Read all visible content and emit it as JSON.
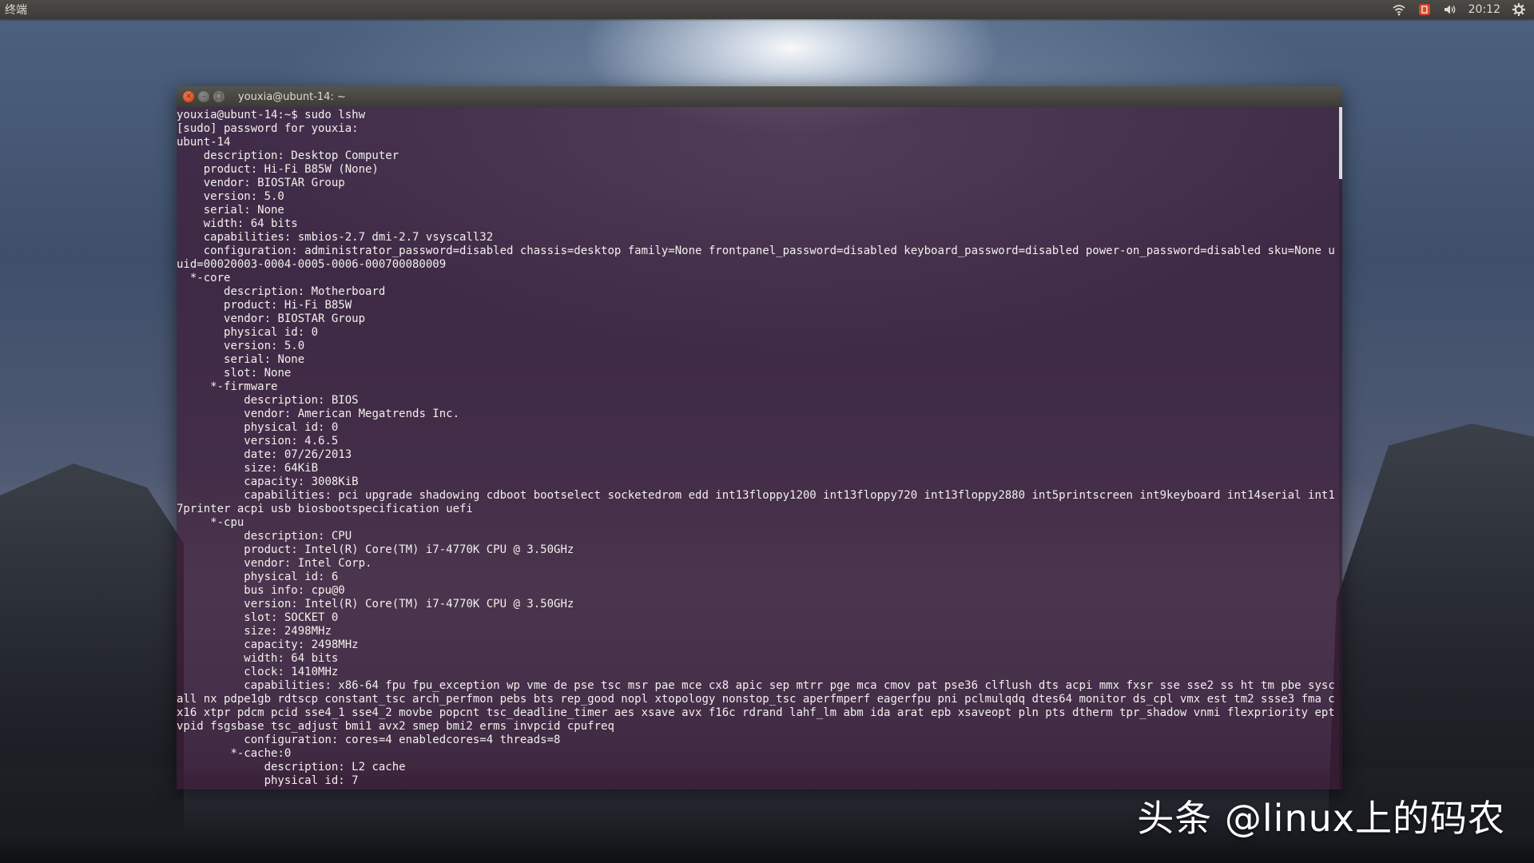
{
  "top_panel": {
    "app_name": "终端",
    "clock": "20:12",
    "indicators": [
      {
        "icon": "wifi-icon"
      },
      {
        "icon": "input-method-icon"
      },
      {
        "icon": "volume-icon"
      },
      {
        "icon": "gear-icon"
      }
    ]
  },
  "window": {
    "title": "youxia@ubunt-14: ~",
    "buttons": [
      "close",
      "minimize",
      "maximize"
    ]
  },
  "terminal": {
    "lines": [
      "youxia@ubunt-14:~$ sudo lshw",
      "[sudo] password for youxia:",
      "ubunt-14",
      "    description: Desktop Computer",
      "    product: Hi-Fi B85W (None)",
      "    vendor: BIOSTAR Group",
      "    version: 5.0",
      "    serial: None",
      "    width: 64 bits",
      "    capabilities: smbios-2.7 dmi-2.7 vsyscall32",
      "    configuration: administrator_password=disabled chassis=desktop family=None frontpanel_password=disabled keyboard_password=disabled power-on_password=disabled sku=None uuid=00020003-0004-0005-0006-000700080009",
      "  *-core",
      "       description: Motherboard",
      "       product: Hi-Fi B85W",
      "       vendor: BIOSTAR Group",
      "       physical id: 0",
      "       version: 5.0",
      "       serial: None",
      "       slot: None",
      "     *-firmware",
      "          description: BIOS",
      "          vendor: American Megatrends Inc.",
      "          physical id: 0",
      "          version: 4.6.5",
      "          date: 07/26/2013",
      "          size: 64KiB",
      "          capacity: 3008KiB",
      "          capabilities: pci upgrade shadowing cdboot bootselect socketedrom edd int13floppy1200 int13floppy720 int13floppy2880 int5printscreen int9keyboard int14serial int17printer acpi usb biosbootspecification uefi",
      "     *-cpu",
      "          description: CPU",
      "          product: Intel(R) Core(TM) i7-4770K CPU @ 3.50GHz",
      "          vendor: Intel Corp.",
      "          physical id: 6",
      "          bus info: cpu@0",
      "          version: Intel(R) Core(TM) i7-4770K CPU @ 3.50GHz",
      "          slot: SOCKET 0",
      "          size: 2498MHz",
      "          capacity: 2498MHz",
      "          width: 64 bits",
      "          clock: 1410MHz",
      "          capabilities: x86-64 fpu fpu_exception wp vme de pse tsc msr pae mce cx8 apic sep mtrr pge mca cmov pat pse36 clflush dts acpi mmx fxsr sse sse2 ss ht tm pbe syscall nx pdpe1gb rdtscp constant_tsc arch_perfmon pebs bts rep_good nopl xtopology nonstop_tsc aperfmperf eagerfpu pni pclmulqdq dtes64 monitor ds_cpl vmx est tm2 ssse3 fma cx16 xtpr pdcm pcid sse4_1 sse4_2 movbe popcnt tsc_deadline_timer aes xsave avx f16c rdrand lahf_lm abm ida arat epb xsaveopt pln pts dtherm tpr_shadow vnmi flexpriority ept vpid fsgsbase tsc_adjust bmi1 avx2 smep bmi2 erms invpcid cpufreq",
      "          configuration: cores=4 enabledcores=4 threads=8",
      "        *-cache:0",
      "             description: L2 cache",
      "             physical id: 7"
    ]
  },
  "watermark": {
    "text": "头条 @linux上的码农"
  }
}
